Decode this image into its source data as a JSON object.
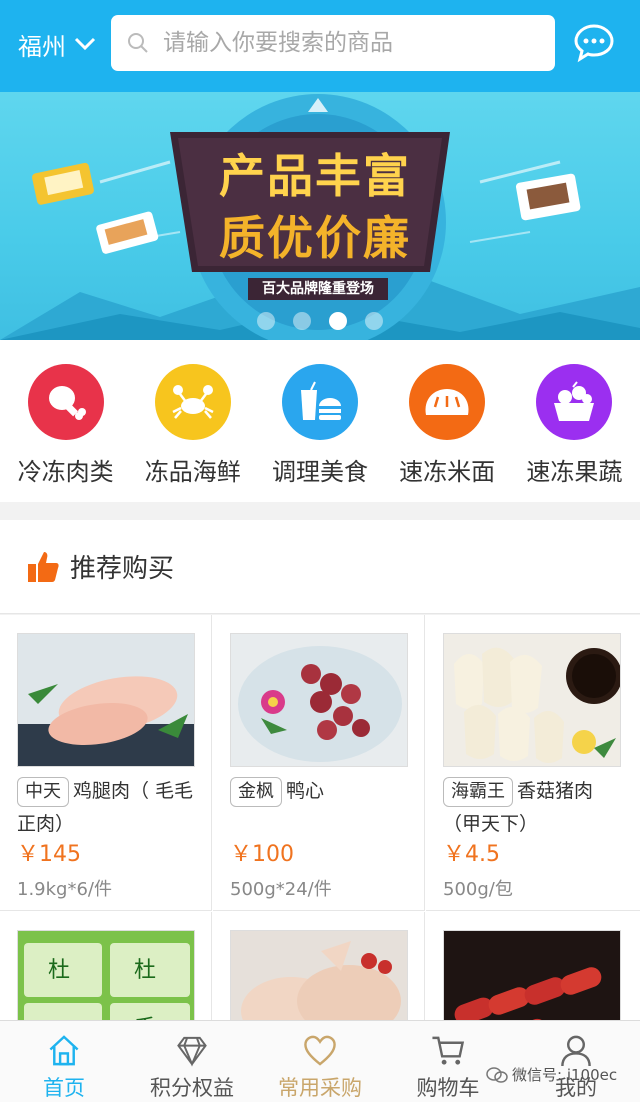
{
  "header": {
    "city": "福州",
    "search_placeholder": "请输入你要搜索的商品"
  },
  "banner": {
    "title_line1": "产品丰富",
    "title_line2": "质优价廉",
    "subtitle": "百大品牌隆重登场",
    "slide_count": 4,
    "active_slide": 3
  },
  "categories": [
    {
      "label": "冷冻肉类",
      "icon": "drumstick-icon",
      "color": "#e8334a"
    },
    {
      "label": "冻品海鲜",
      "icon": "crab-icon",
      "color": "#f7c51e"
    },
    {
      "label": "调理美食",
      "icon": "fastfood-icon",
      "color": "#2aa6ee"
    },
    {
      "label": "速冻米面",
      "icon": "bread-icon",
      "color": "#f36a14"
    },
    {
      "label": "速冻果蔬",
      "icon": "fruit-basket-icon",
      "color": "#9b2ff0"
    }
  ],
  "recommend": {
    "title": "推荐购买"
  },
  "products": [
    {
      "brand": "中天",
      "name": "鸡腿肉（ 毛毛正肉）",
      "price": "￥145",
      "spec": "1.9kg*6/件"
    },
    {
      "brand": "金枫",
      "name": "鸭心",
      "price": "￥100",
      "spec": "500g*24/件"
    },
    {
      "brand": "海霸王",
      "name": "香菇猪肉（甲天下）",
      "price": "￥4.5",
      "spec": "500g/包"
    },
    {
      "brand": "",
      "name": "",
      "price": "",
      "spec": ""
    },
    {
      "brand": "",
      "name": "",
      "price": "",
      "spec": ""
    },
    {
      "brand": "",
      "name": "",
      "price": "",
      "spec": ""
    }
  ],
  "tabbar": [
    {
      "label": "首页",
      "icon": "home-icon"
    },
    {
      "label": "积分权益",
      "icon": "diamond-icon"
    },
    {
      "label": "常用采购",
      "icon": "heart-icon"
    },
    {
      "label": "购物车",
      "icon": "cart-icon"
    },
    {
      "label": "我的",
      "icon": "user-icon"
    }
  ],
  "watermark": "微信号: i100ec",
  "colors": {
    "primary": "#1eb3ef",
    "price": "#f0731f",
    "thumb": "#f36a14"
  }
}
